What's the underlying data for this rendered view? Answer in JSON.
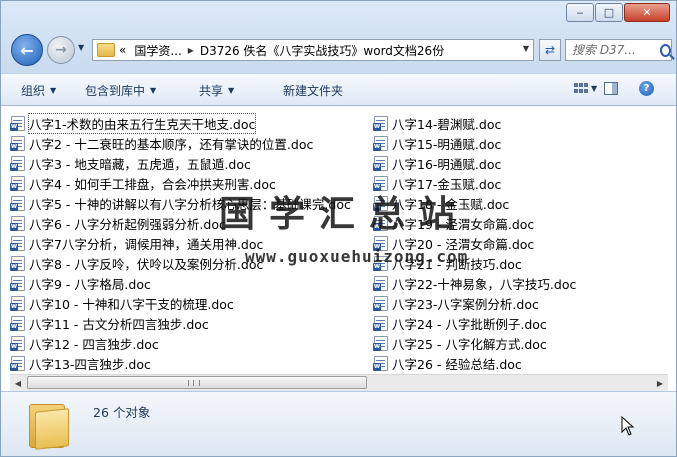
{
  "window": {
    "caption_buttons": [
      "minimize-icon",
      "maximize-icon",
      "close-icon"
    ]
  },
  "address_bar": {
    "crumbs": [
      "«",
      "国学资...",
      "▸",
      "D3726 佚名《八字实战技巧》word文档26份"
    ],
    "search_placeholder": "搜索 D37..."
  },
  "command_bar": {
    "organize": "组织",
    "include_in_library": "包含到库中",
    "share": "共享",
    "new_folder": "新建文件夹"
  },
  "files": {
    "column1": [
      "八字1-术数的由来五行生克天干地支.doc",
      "八字2 - 十二衰旺的基本顺序，还有掌诀的位置.doc",
      "八字3 - 地支暗藏，五虎遁，五鼠遁.doc",
      "八字4 - 如何手工排盘，合会冲拱夹刑害.doc",
      "八字5 - 十神的讲解以有八字分析核心思层：基础课完.doc",
      "八字6 - 八字分析起例强弱分析.doc",
      "八字7八字分析，调候用神，通关用神.doc",
      "八字8 - 八字反呤，伏呤以及案例分析.doc",
      "八字9 - 八字格局.doc",
      "八字10 - 十神和八字干支的梳理.doc",
      "八字11 - 古文分析四言独步.doc",
      "八字12 - 四言独步.doc",
      "八字13-四言独步.doc"
    ],
    "column2": [
      "八字14-碧渊赋.doc",
      "八字15-明通赋.doc",
      "八字16-明通赋.doc",
      "八字17-金玉赋.doc",
      "八字18 - 金玉赋.doc",
      "八字19 - 泾渭女命篇.doc",
      "八字20 - 泾渭女命篇.doc",
      "八字21 - 判断技巧.doc",
      "八字22-十神易象，八字技巧.doc",
      "八字23-八字案例分析.doc",
      "八字24 - 八字批断例子.doc",
      "八字25 - 八字化解方式.doc",
      "八字26 - 经验总结.doc"
    ]
  },
  "watermark": {
    "text": "国学汇总站",
    "url": "www.guoxuehuizong.com"
  },
  "details_pane": {
    "object_count": "26 个对象"
  },
  "colors": {
    "command_text": "#1e395b",
    "chrome_top": "#dce9f7",
    "close_button": "#c7402b"
  }
}
